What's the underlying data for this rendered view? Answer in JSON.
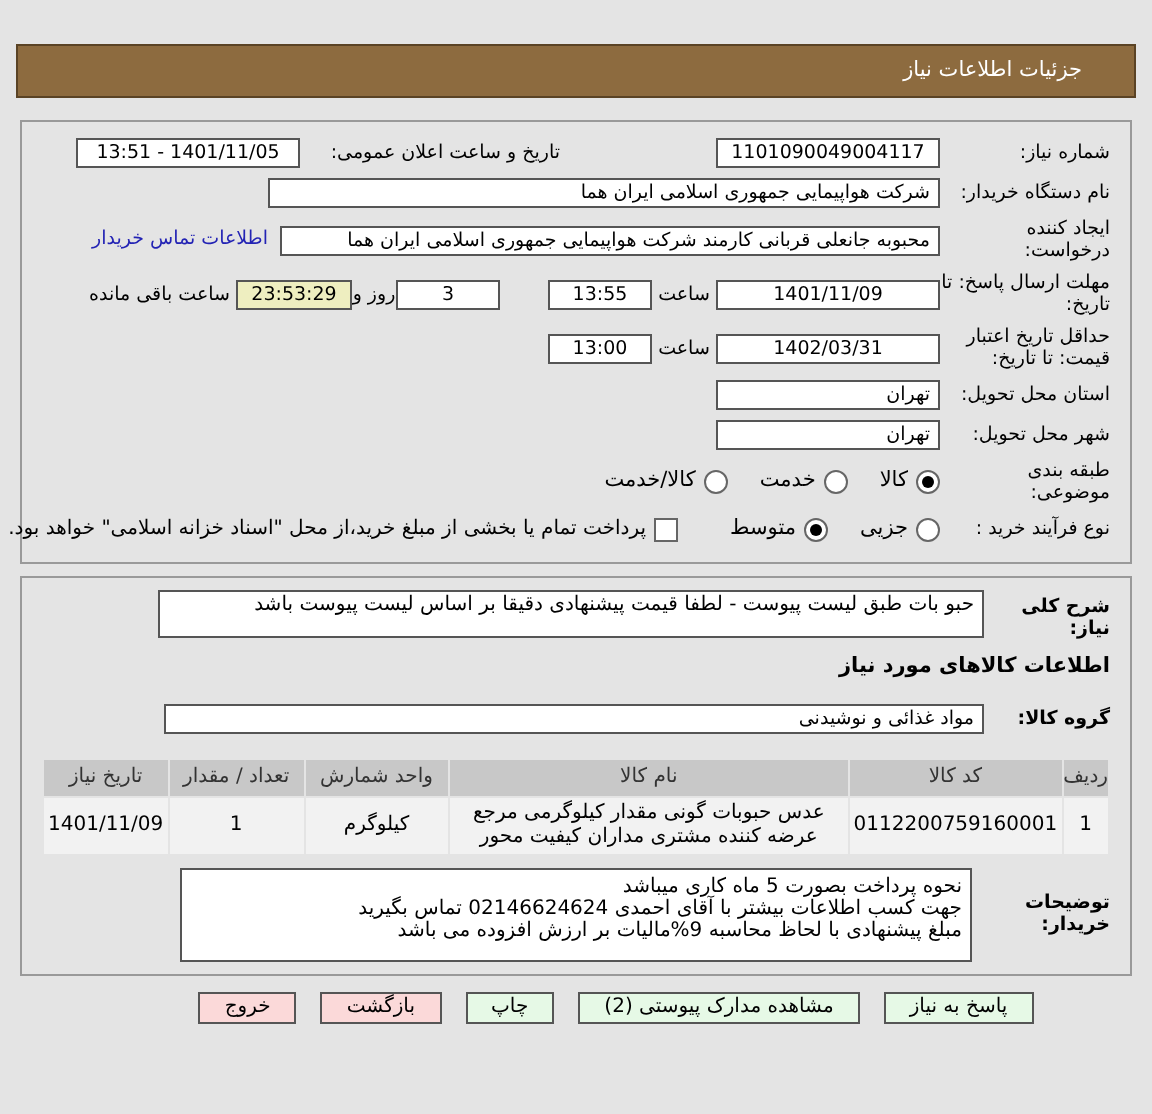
{
  "page_title": "جزئیات اطلاعات نیاز",
  "need_number": {
    "label": "شماره نیاز:",
    "value": "1101090049004117"
  },
  "announce": {
    "label": "تاریخ و ساعت اعلان عمومی:",
    "value": "1401/11/05 - 13:51"
  },
  "buyer": {
    "label": "نام دستگاه خریدار:",
    "value": "شرکت هواپیمایی جمهوری اسلامی ایران هما"
  },
  "requester": {
    "label": "ایجاد کننده درخواست:",
    "value": "محبوبه جانعلی قربانی کارمند شرکت هواپیمایی جمهوری اسلامی ایران هما",
    "link": "اطلاعات تماس خریدار"
  },
  "deadline": {
    "label": "مهلت ارسال پاسخ: تا تاریخ:",
    "date": "1401/11/09",
    "time_label": "ساعت",
    "time": "13:55",
    "days": "3",
    "days_label": "روز و",
    "remaining": "23:53:29",
    "remaining_label": "ساعت باقی مانده"
  },
  "validity": {
    "label": "حداقل تاریخ اعتبار قیمت: تا تاریخ:",
    "date": "1402/03/31",
    "time_label": "ساعت",
    "time": "13:00"
  },
  "province": {
    "label": "استان محل تحویل:",
    "value": "تهران"
  },
  "city": {
    "label": "شهر محل تحویل:",
    "value": "تهران"
  },
  "category": {
    "label": "طبقه بندی موضوعی:",
    "options": [
      {
        "label": "کالا",
        "selected": true
      },
      {
        "label": "خدمت",
        "selected": false
      },
      {
        "label": "کالا/خدمت",
        "selected": false
      }
    ]
  },
  "purchase": {
    "label": "نوع فرآیند خرید :",
    "options": [
      {
        "label": "جزیی",
        "selected": false
      },
      {
        "label": "متوسط",
        "selected": true
      }
    ],
    "payment": {
      "label": "پرداخت تمام یا بخشی از مبلغ خرید،از محل \"اسناد خزانه اسلامی\" خواهد بود.",
      "checked": false
    }
  },
  "description": {
    "label": "شرح کلی نیاز:",
    "value": "حبو بات طبق لیست پیوست  - لطفا قیمت پیشنهادی   دقیقا بر اساس لیست پیوست باشد"
  },
  "goods_title": "اطلاعات کالاهای مورد نیاز",
  "goods_group": {
    "label": "گروه کالا:",
    "value": "مواد غذائی و نوشیدنی"
  },
  "table": {
    "columns": [
      "ردیف",
      "کد کالا",
      "نام کالا",
      "واحد شمارش",
      "تعداد / مقدار",
      "تاریخ نیاز"
    ],
    "rows": [
      [
        "1",
        "0112200759160001",
        "عدس حبوبات گونی مقدار کیلوگرمی مرجع عرضه کننده مشتری مداران کیفیت محور",
        "کیلوگرم",
        "1",
        "1401/11/09"
      ]
    ]
  },
  "buyer_notes": {
    "label": "توضیحات خریدار:",
    "lines": [
      "نحوه پرداخت بصورت 5 ماه کاری میباشد",
      "جهت کسب اطلاعات بیشتر با آقای احمدی 02146624624 تماس بگیرید",
      "مبلغ پیشنهادی با لحاظ محاسبه 9%مالیات بر ارزش افزوده می باشد"
    ]
  },
  "buttons": [
    {
      "label": "پاسخ به نیاز",
      "kind": "primary"
    },
    {
      "label": "مشاهده مدارک پیوستی (2)",
      "kind": "primary"
    },
    {
      "label": "چاپ",
      "kind": "primary"
    },
    {
      "label": "بازگشت",
      "kind": "danger"
    },
    {
      "label": "خروج",
      "kind": "danger"
    }
  ]
}
